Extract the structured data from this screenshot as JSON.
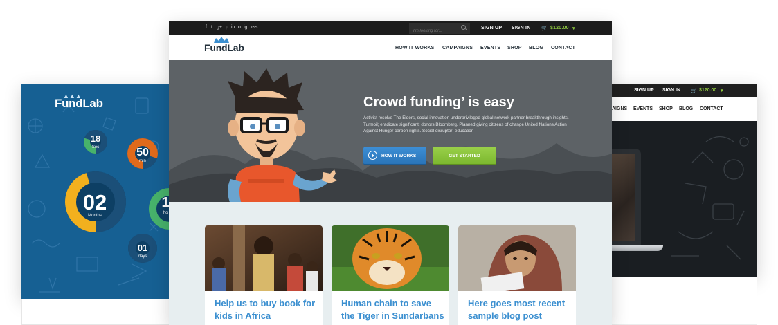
{
  "left_preview": {
    "brand": "FundLab",
    "countdown": [
      {
        "value": "18",
        "unit": "Sec",
        "fraction": 0.3,
        "color": "#47b26b"
      },
      {
        "value": "50",
        "unit": "min",
        "fraction": 0.8,
        "color": "#e06a1b"
      },
      {
        "value": "02",
        "unit": "Months",
        "fraction": 0.45,
        "color": "#f2b01e"
      },
      {
        "value": "1",
        "unit": "ho",
        "fraction": 0.55,
        "color": "#47b26b"
      },
      {
        "value": "01",
        "unit": "days",
        "fraction": 0.0,
        "color": "#0f3f63"
      }
    ]
  },
  "right_preview": {
    "top_links": [
      "SIGN UP",
      "SIGN IN"
    ],
    "cart": "$120.00",
    "nav": [
      "AIGNS",
      "EVENTS",
      "SHOP",
      "BLOG",
      "CONTACT"
    ]
  },
  "main": {
    "social_icons": [
      "f",
      "t",
      "g+",
      "p",
      "in",
      "o",
      "ig",
      "rss"
    ],
    "social_icon_names": [
      "facebook-icon",
      "twitter-icon",
      "google-plus-icon",
      "pinterest-icon",
      "linkedin-icon",
      "dribbble-icon",
      "instagram-icon",
      "rss-icon"
    ],
    "search_placeholder": "I'm looking for...",
    "sign_up": "SIGN UP",
    "sign_in": "SIGN IN",
    "cart_amount": "$120.00",
    "logo": "FundLab",
    "nav": [
      "HOW IT WORKS",
      "CAMPAIGNS",
      "EVENTS",
      "SHOP",
      "BLOG",
      "CONTACT"
    ],
    "hero": {
      "title": "Crowd funding’ is easy",
      "text": "Activist resolve The Elders, social innovation underprivileged global network partner breakthrough insights. Turmoil; eradicate significant; donors Bloomberg. Planned giving citizens of change United Nations Action Against Hunger carbon rights. Social disruptor; education",
      "primary_button": "HOW IT WORKS",
      "secondary_button": "GET STARTED"
    },
    "cards": [
      {
        "title": "Help us to buy book for kids in Africa"
      },
      {
        "title": "Human chain to save the Tiger in Sundarbans"
      },
      {
        "title": "Here goes most recent sample blog post"
      }
    ]
  },
  "colors": {
    "accent_blue": "#3b8fd0",
    "accent_green": "#8ec63f",
    "left_bg": "#166093",
    "hero_bg": "#5d6266",
    "topbar": "#1c1c1c"
  }
}
